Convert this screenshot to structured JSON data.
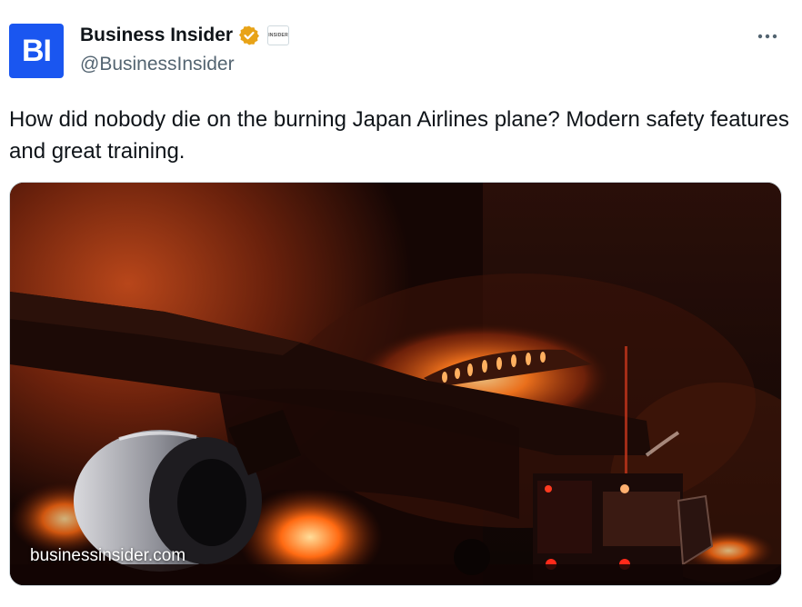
{
  "author": {
    "avatar_text": "BI",
    "display_name": "Business Insider",
    "handle": "@BusinessInsider",
    "verified_badge_color": "#e8a317",
    "affiliate_badge_text": "INSIDER"
  },
  "menu": {
    "icon": "more-dots-icon"
  },
  "tweet": {
    "text": "How did nobody die on the burning Japan Airlines plane? Modern safety features and great training."
  },
  "media": {
    "caption": "businessinsider.com",
    "description_icon": "photo"
  },
  "colors": {
    "avatar_bg": "#1a56f0",
    "text_primary": "#0f1419",
    "text_secondary": "#536471"
  }
}
